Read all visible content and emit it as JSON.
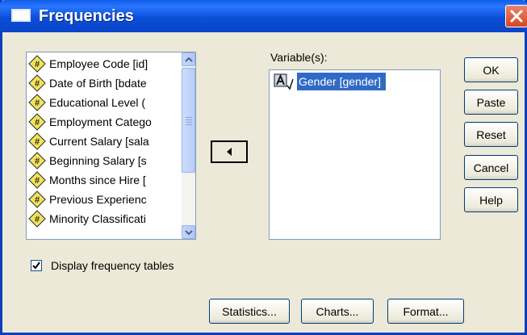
{
  "window": {
    "title": "Frequencies"
  },
  "source_list": {
    "items": [
      "Employee Code [id]",
      "Date of Birth [bdate",
      "Educational Level (",
      "Employment Catego",
      "Current Salary [sala",
      "Beginning Salary [s",
      "Months since Hire [",
      "Previous Experienc",
      "Minority Classificati"
    ]
  },
  "variables": {
    "label": "Variable(s):",
    "items": [
      "Gender [gender]"
    ]
  },
  "side_buttons": {
    "ok": "OK",
    "paste": "Paste",
    "reset": "Reset",
    "cancel": "Cancel",
    "help": "Help"
  },
  "options": {
    "display_frequency_tables": "Display frequency tables",
    "checked": true
  },
  "bottom_buttons": {
    "statistics": "Statistics...",
    "charts": "Charts...",
    "format": "Format..."
  },
  "colors": {
    "title_bar": "#0a4fd8",
    "dialog_bg": "#ece9d8",
    "selection": "#316ac5",
    "numeric_icon": "#f3e35a",
    "close_button": "#d8451f"
  },
  "icons": {
    "numeric_variable": "numeric-variable-icon",
    "string_variable": "string-variable-icon",
    "move_arrow": "arrow-left-icon"
  }
}
